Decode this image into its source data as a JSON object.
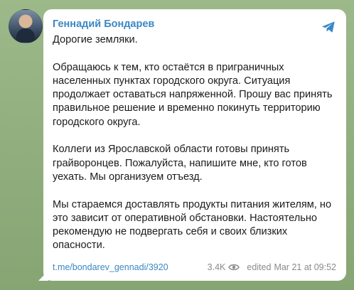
{
  "post": {
    "author": "Геннадий Бондарев",
    "paragraphs": [
      "Дорогие земляки.",
      "Обращаюсь к тем, кто остаётся в приграничных населенных пунктах городского округа. Ситуация продолжает оставаться напряженной. Прошу вас принять правильное решение и временно покинуть территорию городского округа.",
      "Коллеги из Ярославской области готовы принять грайворонцев. Пожалуйста, напишите мне, кто готов уехать. Мы организуем отъезд.",
      "Мы стараемся доставлять продукты питания жителям, но это зависит от оперативной обстановки. Настоятельно рекомендую не подвергать себя и своих близких опасности."
    ],
    "link": "t.me/bondarev_gennadi/3920",
    "views": "3.4K",
    "edited_label": "edited",
    "timestamp": "Mar 21 at 09:52"
  },
  "icons": {
    "share": "telegram-plane-icon",
    "views": "eye-icon"
  },
  "colors": {
    "accent": "#3a88c4",
    "bubble": "#ffffff",
    "background": "#8fae7e"
  }
}
